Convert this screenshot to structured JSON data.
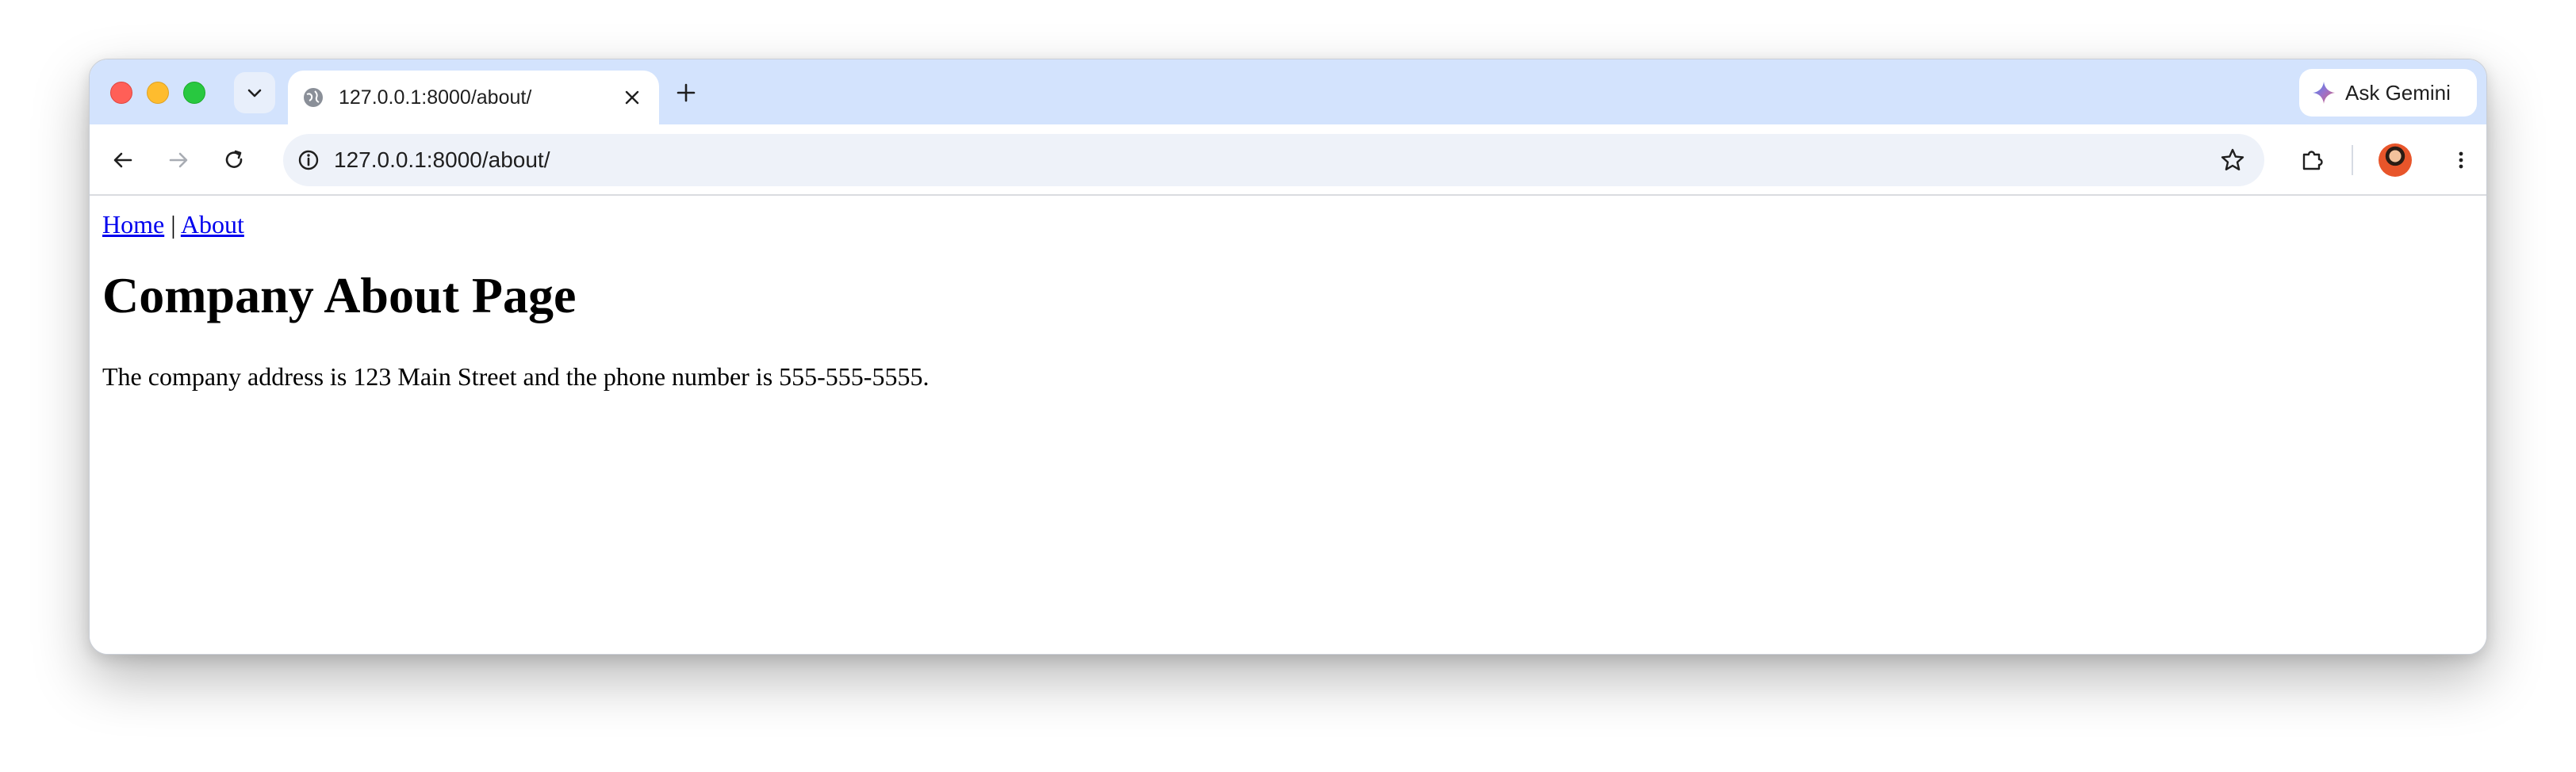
{
  "browser": {
    "tab": {
      "title": "127.0.0.1:8000/about/",
      "favicon": "globe-icon",
      "close_icon": "close-icon"
    },
    "new_tab_icon": "plus-icon",
    "tab_search_icon": "chevron-down-icon",
    "ask_gemini_label": "Ask Gemini",
    "toolbar": {
      "back_icon": "arrow-left-icon",
      "forward_icon": "arrow-right-icon",
      "reload_icon": "reload-icon",
      "site_info_icon": "info-icon",
      "url": "127.0.0.1:8000/about/",
      "bookmark_icon": "star-icon",
      "extensions_icon": "puzzle-icon",
      "menu_icon": "kebab-menu-icon"
    },
    "colors": {
      "tabstrip": "#d3e3fd",
      "omnibox": "#eef2f9",
      "link": "#0000ee"
    }
  },
  "page": {
    "nav": {
      "home_label": "Home",
      "separator": "|",
      "about_label": "About"
    },
    "title": "Company About Page",
    "body_text": "The company address is 123 Main Street and the phone number is 555-555-5555."
  }
}
